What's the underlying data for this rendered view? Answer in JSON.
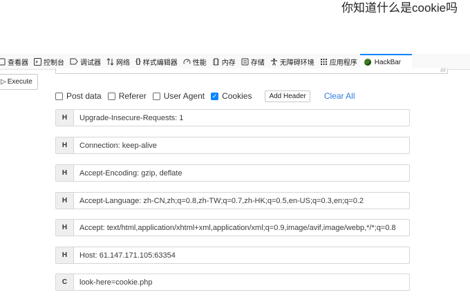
{
  "page": {
    "title": "你知道什么是cookie吗"
  },
  "toolbar": {
    "tabs": [
      {
        "icon": "inspector-icon",
        "label": "查看器"
      },
      {
        "icon": "console-icon",
        "label": "控制台"
      },
      {
        "icon": "debugger-icon",
        "label": "调试器"
      },
      {
        "icon": "network-icon",
        "label": "网络"
      },
      {
        "icon": "style-editor-icon",
        "label": "样式编辑器"
      },
      {
        "icon": "performance-icon",
        "label": "性能"
      },
      {
        "icon": "memory-icon",
        "label": "内存"
      },
      {
        "icon": "storage-icon",
        "label": "存储"
      },
      {
        "icon": "accessibility-icon",
        "label": "无障碍环境"
      },
      {
        "icon": "application-icon",
        "label": "应用程序"
      },
      {
        "icon": "hackbar-icon",
        "label": "HackBar",
        "active": true
      }
    ]
  },
  "hackbar": {
    "execute_label": "Execute",
    "options": [
      {
        "label": "Post data",
        "checked": false
      },
      {
        "label": "Referer",
        "checked": false
      },
      {
        "label": "User Agent",
        "checked": false
      },
      {
        "label": "Cookies",
        "checked": true
      }
    ],
    "add_header_label": "Add Header",
    "clear_all_label": "Clear All",
    "headers": [
      {
        "type": "H",
        "value": "Upgrade-Insecure-Requests: 1"
      },
      {
        "type": "H",
        "value": "Connection: keep-alive"
      },
      {
        "type": "H",
        "value": "Accept-Encoding: gzip, deflate"
      },
      {
        "type": "H",
        "value": "Accept-Language: zh-CN,zh;q=0.8,zh-TW;q=0.7,zh-HK;q=0.5,en-US;q=0.3,en;q=0.2"
      },
      {
        "type": "H",
        "value": "Accept: text/html,application/xhtml+xml,application/xml;q=0.9,image/avif,image/webp,*/*;q=0.8"
      },
      {
        "type": "H",
        "value": "Host: 61.147.171.105:63354"
      },
      {
        "type": "C",
        "value": "look-here=cookie.php"
      }
    ]
  },
  "colors": {
    "accent": "#0a84ff",
    "link": "#2f7de1"
  }
}
